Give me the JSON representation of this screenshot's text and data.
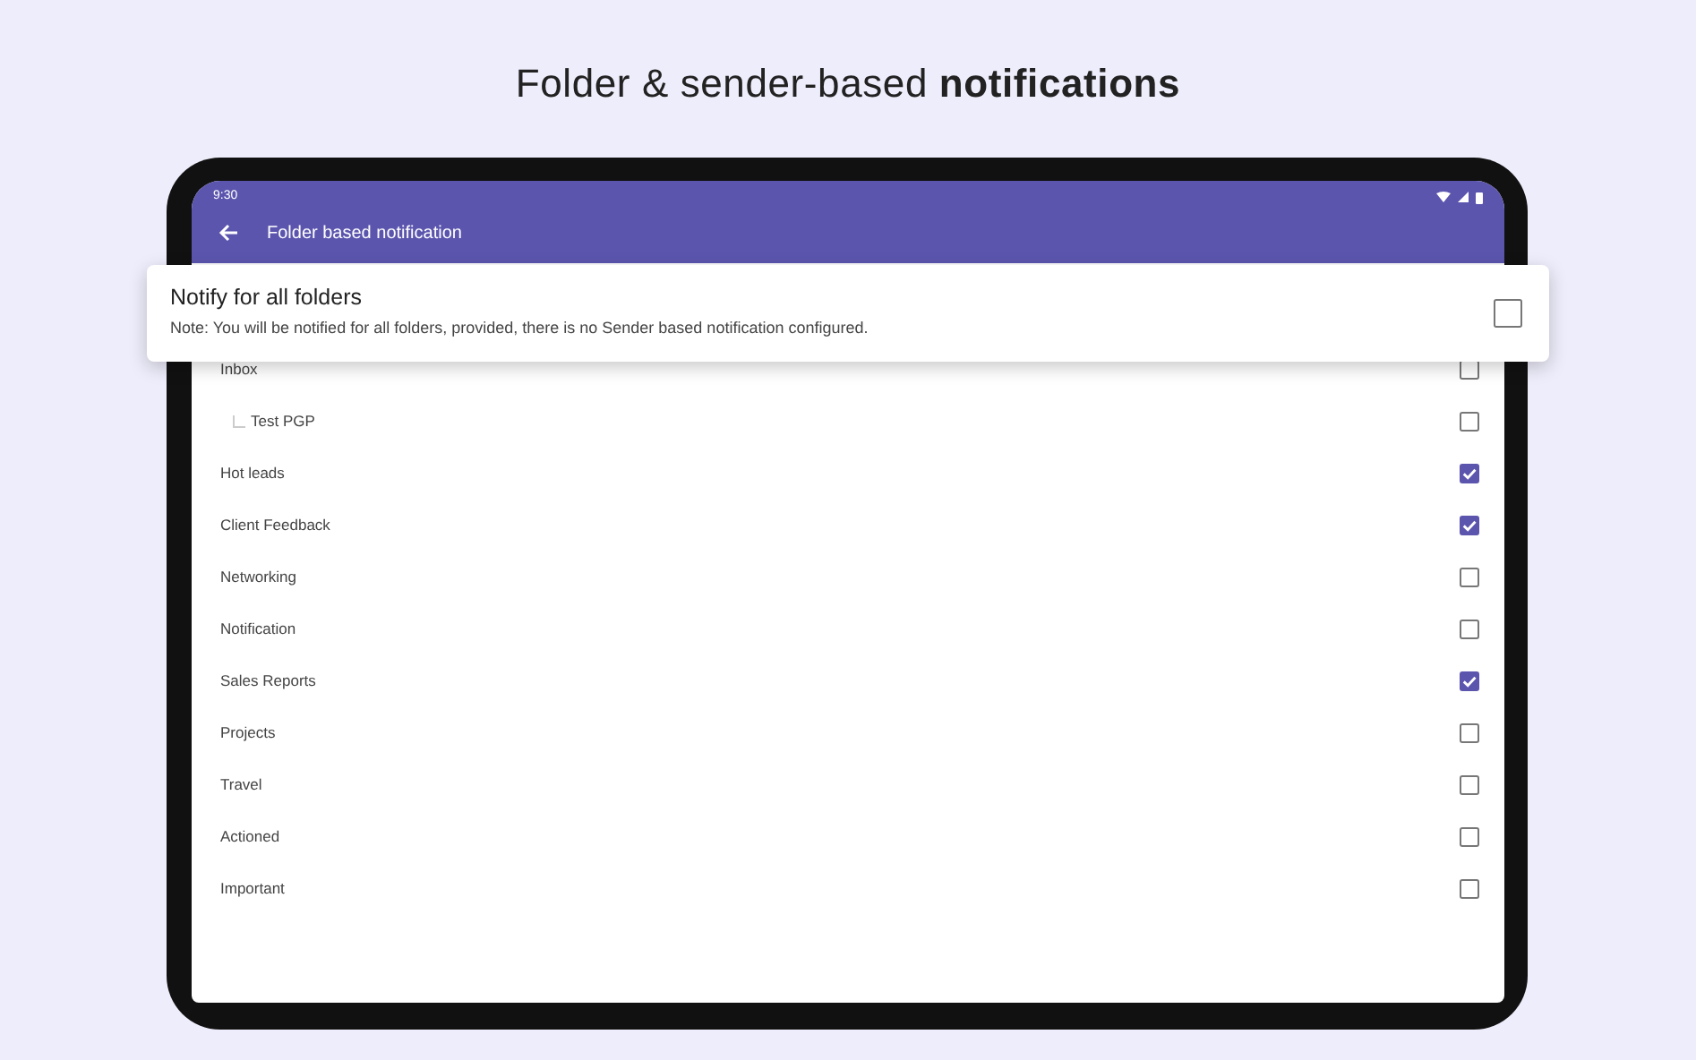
{
  "headline": {
    "text": "Folder & sender-based **notifications**"
  },
  "status_bar": {
    "time": "9:30"
  },
  "app_bar": {
    "title": "Folder based notification"
  },
  "notify_all": {
    "title": "Notify for all folders",
    "note": "Note: You will be notified for all folders, provided, there is no Sender based notification configured.",
    "checked": false
  },
  "folders": [
    {
      "name": "Inbox",
      "checked": false,
      "children": [
        {
          "name": "Test PGP",
          "checked": false
        }
      ]
    },
    {
      "name": "Hot leads",
      "checked": true
    },
    {
      "name": "Client Feedback",
      "checked": true
    },
    {
      "name": "Networking",
      "checked": false
    },
    {
      "name": "Notification",
      "checked": false
    },
    {
      "name": "Sales Reports",
      "checked": true
    },
    {
      "name": "Projects",
      "checked": false
    },
    {
      "name": "Travel",
      "checked": false
    },
    {
      "name": "Actioned",
      "checked": false
    },
    {
      "name": "Important",
      "checked": false
    }
  ]
}
